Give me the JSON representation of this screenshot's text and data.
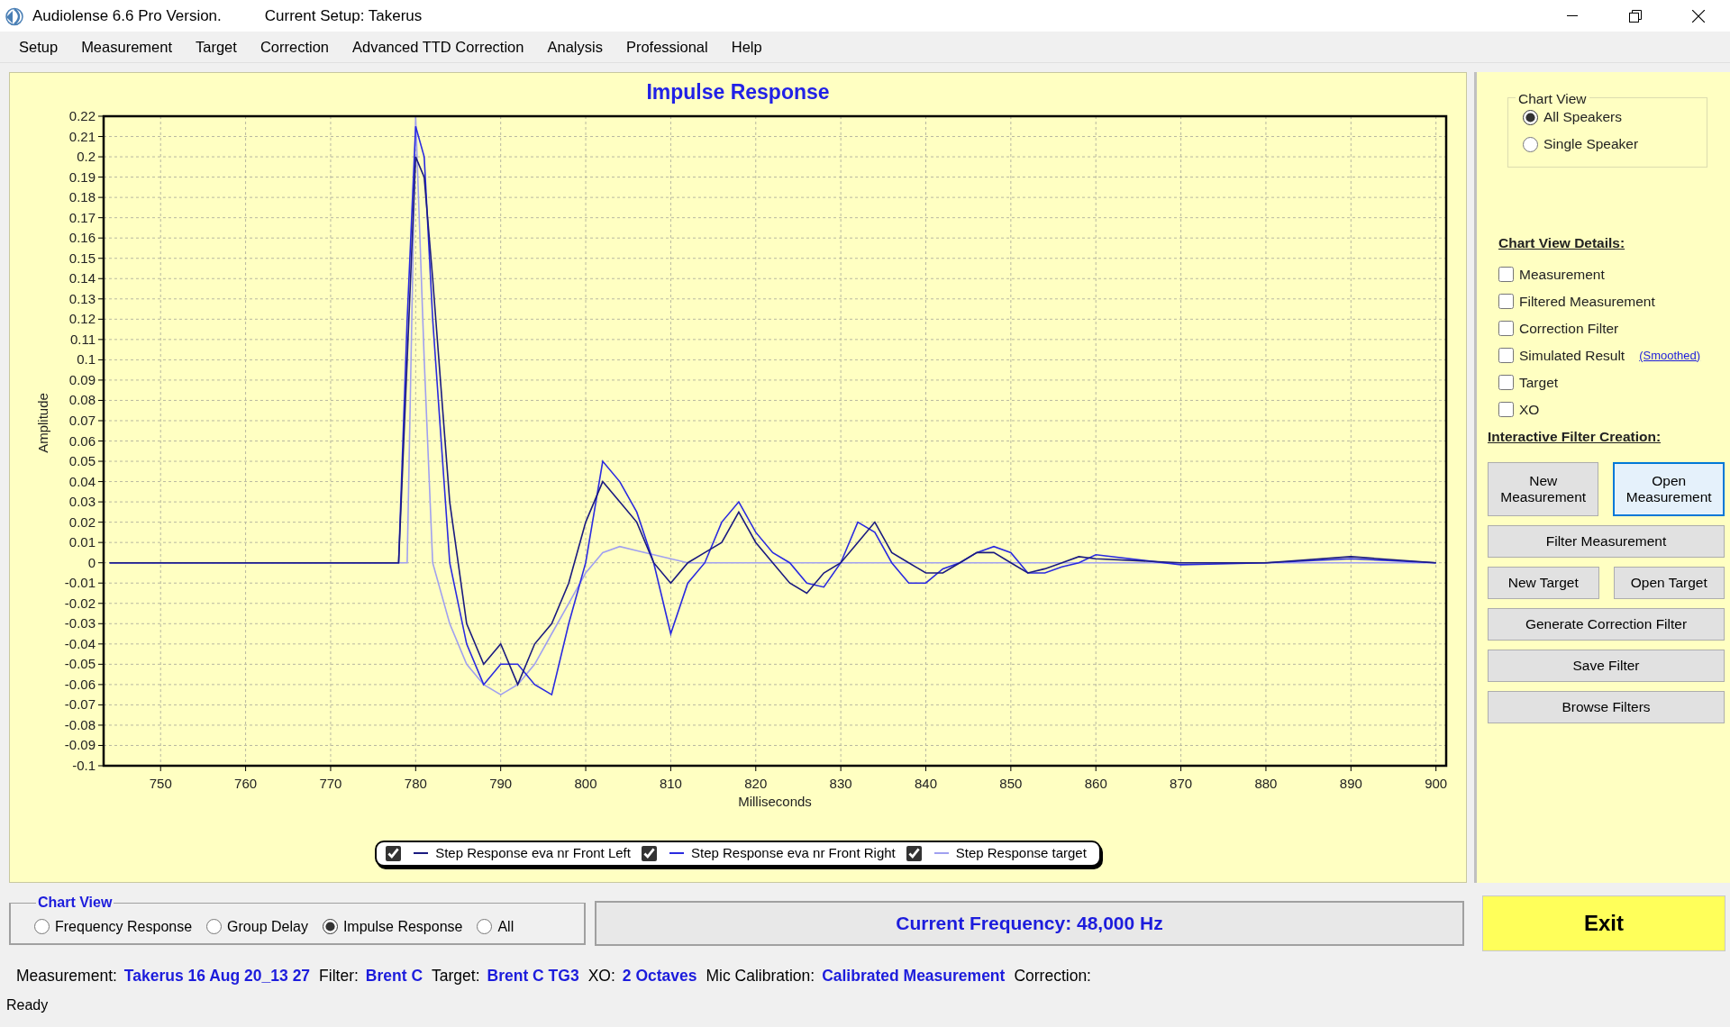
{
  "window": {
    "title": "Audiolense 6.6 Pro Version.",
    "setup": "Current Setup: Takerus"
  },
  "menu": [
    "Setup",
    "Measurement",
    "Target",
    "Correction",
    "Advanced TTD Correction",
    "Analysis",
    "Professional",
    "Help"
  ],
  "chart": {
    "chart_data": {
      "type": "line",
      "title": "Impulse Response",
      "xlabel": "Milliseconds",
      "ylabel": "Amplitude",
      "x": [
        744,
        760,
        778,
        779,
        780,
        781,
        782,
        784,
        786,
        788,
        790,
        792,
        794,
        796,
        798,
        800,
        802,
        804,
        806,
        808,
        810,
        812,
        814,
        816,
        818,
        820,
        822,
        824,
        826,
        828,
        830,
        832,
        834,
        836,
        838,
        840,
        842,
        844,
        846,
        848,
        850,
        852,
        854,
        856,
        858,
        860,
        870,
        880,
        890,
        900
      ],
      "series": [
        {
          "name": "Step Response eva nr Front Left",
          "color": "#1a1a80",
          "values": [
            0,
            0,
            0,
            0.1,
            0.2,
            0.19,
            0.14,
            0.03,
            -0.03,
            -0.05,
            -0.04,
            -0.06,
            -0.04,
            -0.03,
            -0.01,
            0.02,
            0.04,
            0.03,
            0.02,
            0,
            -0.01,
            0,
            0.005,
            0.01,
            0.025,
            0.01,
            0,
            -0.01,
            -0.015,
            -0.005,
            0,
            0.01,
            0.02,
            0.005,
            0,
            -0.005,
            -0.005,
            0,
            0.005,
            0.005,
            0,
            -0.005,
            -0.003,
            0,
            0.003,
            0.002,
            0,
            0,
            0.003,
            0
          ]
        },
        {
          "name": "Step Response eva nr Front Right",
          "color": "#2a2ae0",
          "values": [
            0,
            0,
            0,
            0.12,
            0.215,
            0.2,
            0.12,
            0,
            -0.04,
            -0.06,
            -0.05,
            -0.05,
            -0.06,
            -0.065,
            -0.03,
            0,
            0.05,
            0.04,
            0.025,
            0,
            -0.035,
            -0.01,
            0,
            0.02,
            0.03,
            0.015,
            0.005,
            0,
            -0.01,
            -0.012,
            0,
            0.02,
            0.015,
            0,
            -0.01,
            -0.01,
            -0.003,
            0,
            0.005,
            0.008,
            0.005,
            -0.005,
            -0.005,
            -0.002,
            0,
            0.004,
            -0.001,
            0,
            0.002,
            0
          ]
        },
        {
          "name": "Step Response target",
          "color": "#a0a0f0",
          "values": [
            0,
            0,
            0,
            0,
            0.22,
            0.1,
            0,
            -0.03,
            -0.05,
            -0.06,
            -0.065,
            -0.06,
            -0.05,
            -0.035,
            -0.02,
            -0.005,
            0.005,
            0.008,
            0.006,
            0.004,
            0.002,
            0,
            0,
            0,
            0,
            0,
            0,
            0,
            0,
            0,
            0,
            0,
            0,
            0,
            0,
            0,
            0,
            0,
            0,
            0,
            0,
            0,
            0,
            0,
            0,
            0,
            0,
            0,
            0,
            0
          ]
        }
      ],
      "grid": true,
      "xlim": [
        743.3,
        901.2
      ],
      "ylim": [
        -0.1,
        0.22
      ],
      "xticks": [
        750,
        760,
        770,
        780,
        790,
        800,
        810,
        820,
        830,
        840,
        850,
        860,
        870,
        880,
        890,
        900
      ],
      "yticks": [
        -0.1,
        -0.09,
        -0.08,
        -0.07,
        -0.06,
        -0.05,
        -0.04,
        -0.03,
        -0.02,
        -0.01,
        0,
        0.01,
        0.02,
        0.03,
        0.04,
        0.05,
        0.06,
        0.07,
        0.08,
        0.09,
        0.1,
        0.11,
        0.12,
        0.13,
        0.14,
        0.15,
        0.16,
        0.17,
        0.18,
        0.19,
        0.2,
        0.21,
        0.22
      ]
    },
    "legend": [
      {
        "checked": true
      },
      {
        "checked": true
      },
      {
        "checked": true
      }
    ]
  },
  "right_panel": {
    "chart_view": {
      "title": "Chart View",
      "options": [
        {
          "label": "All Speakers",
          "selected": true
        },
        {
          "label": "Single Speaker",
          "selected": false
        }
      ]
    },
    "details": {
      "title": "Chart View Details:",
      "items": [
        {
          "label": "Measurement",
          "checked": false
        },
        {
          "label": "Filtered Measurement",
          "checked": false
        },
        {
          "label": "Correction Filter",
          "checked": false
        },
        {
          "label": "Simulated Result",
          "checked": false,
          "link": "(Smoothed)"
        },
        {
          "label": "Target",
          "checked": false
        },
        {
          "label": "XO",
          "checked": false
        }
      ]
    },
    "filter_creation": {
      "title": "Interactive Filter Creation:",
      "button_rows": [
        [
          {
            "label": "New Measurement",
            "focused": false
          },
          {
            "label": "Open Measurement",
            "focused": true
          }
        ],
        [
          {
            "label": "Filter Measurement",
            "focused": false
          }
        ],
        [
          {
            "label": "New Target",
            "focused": false
          },
          {
            "label": "Open Target",
            "focused": false
          }
        ],
        [
          {
            "label": "Generate Correction Filter",
            "focused": false
          }
        ],
        [
          {
            "label": "Save Filter",
            "focused": false
          }
        ],
        [
          {
            "label": "Browse Filters",
            "focused": false
          }
        ]
      ]
    }
  },
  "bottom": {
    "chart_view": {
      "title": "Chart View",
      "options": [
        {
          "label": "Frequency Response",
          "selected": false
        },
        {
          "label": "Group Delay",
          "selected": false
        },
        {
          "label": "Impulse Response",
          "selected": true
        },
        {
          "label": "All",
          "selected": false
        }
      ]
    },
    "current_frequency": "Current Frequency: 48,000 Hz",
    "exit": "Exit"
  },
  "info_bar": [
    {
      "label": "Measurement:",
      "value": "Takerus 16 Aug 20_13 27"
    },
    {
      "label": "Filter:",
      "value": "Brent C"
    },
    {
      "label": "Target:",
      "value": "Brent C TG3"
    },
    {
      "label": "XO:",
      "value": "2 Octaves"
    },
    {
      "label": "Mic Calibration:",
      "value": "Calibrated Measurement"
    },
    {
      "label": "Correction:"
    }
  ],
  "status": "Ready"
}
